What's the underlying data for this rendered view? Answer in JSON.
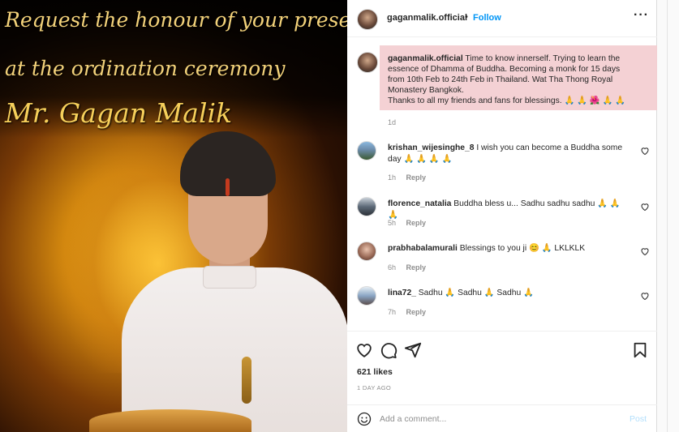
{
  "image": {
    "line1": "Request the honour of your presence",
    "line2": "at the ordination ceremony",
    "line3": "Mr. Gagan Malik"
  },
  "header": {
    "username": "gaganmalik.official",
    "separator": "•",
    "follow": "Follow",
    "more": "···"
  },
  "caption": {
    "username": "gaganmalik.official",
    "text1": "Time to know innerself. Trying to learn the essence of Dhamma of Buddha. Becoming a monk for 15 days from 10th Feb to 24th Feb in Thailand. Wat Tha Thong Royal Monastery Bangkok.",
    "text2": "Thanks to all my friends and fans for blessings. 🙏 🙏 🌺 🙏 🙏",
    "time": "1d"
  },
  "comments": [
    {
      "username": "krishan_wijesinghe_8",
      "text": "I wish you can become a Buddha some day 🙏 🙏 🙏 🙏",
      "time": "1h",
      "reply": "Reply"
    },
    {
      "username": "florence_natalia",
      "text": "Buddha bless u... Sadhu sadhu sadhu 🙏 🙏 🙏",
      "time": "5h",
      "reply": "Reply"
    },
    {
      "username": "prabhabalamurali",
      "text": "Blessings to you ji 😊 🙏 LKLKLK",
      "time": "6h",
      "reply": "Reply"
    },
    {
      "username": "lina72_",
      "text": "Sadhu 🙏 Sadhu 🙏 Sadhu 🙏",
      "time": "7h",
      "reply": "Reply"
    }
  ],
  "actions": {
    "icons": [
      "heart-icon",
      "comment-icon",
      "share-icon",
      "bookmark-icon"
    ],
    "likes": "621 likes",
    "date": "1 DAY AGO"
  },
  "add_comment": {
    "placeholder": "Add a comment...",
    "post": "Post"
  },
  "colors": {
    "follow": "#0095f6",
    "caption_highlight": "#f3cfd2",
    "post_disabled": "#b2dffc",
    "invite_text": "#f3d27a"
  }
}
